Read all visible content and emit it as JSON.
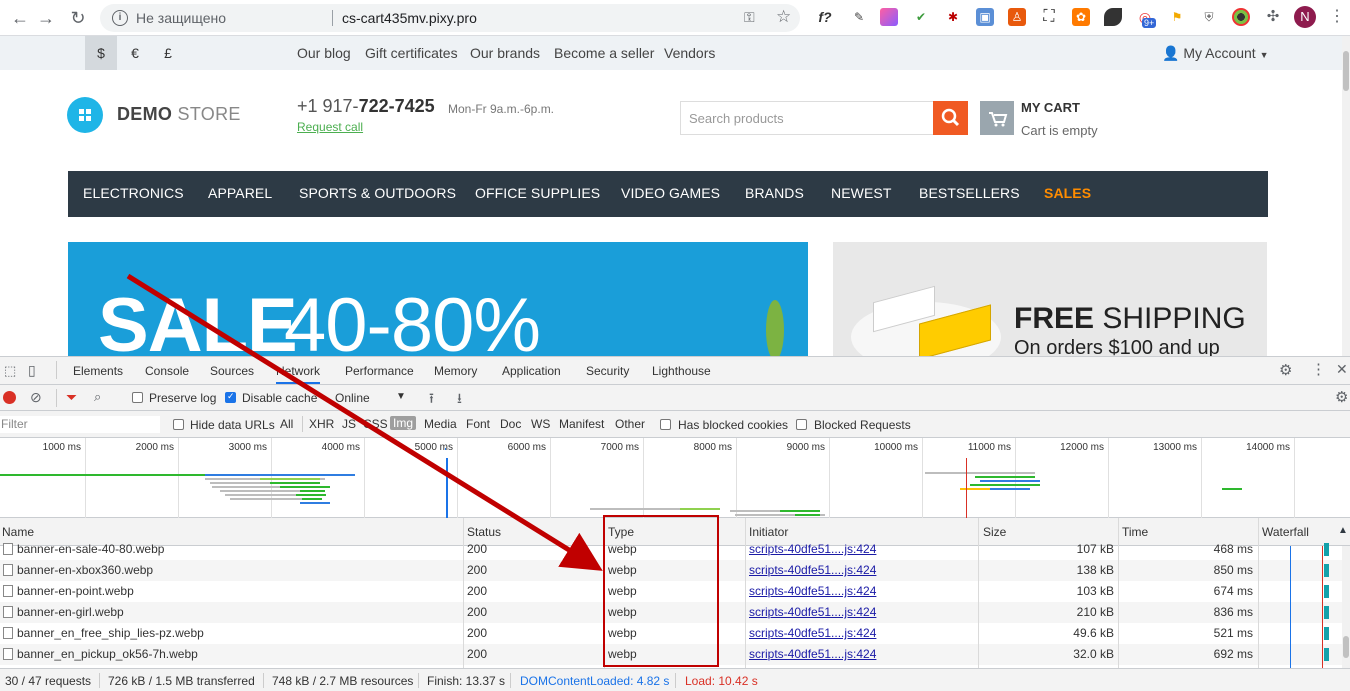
{
  "browser": {
    "security_label": "Не защищено",
    "url": "cs-cart435mv.pixy.pro",
    "avatar_letter": "N",
    "ext_badge": "9+"
  },
  "store": {
    "currencies": [
      "$",
      "€",
      "£"
    ],
    "top_links": [
      "Our blog",
      "Gift certificates",
      "Our brands",
      "Become a seller",
      "Vendors"
    ],
    "my_account": "My Account",
    "logo_bold": "DEMO",
    "logo_light": "STORE",
    "phone_prefix": "+1 917-",
    "phone_main": "722-7425",
    "hours": "Mon-Fr 9a.m.-6p.m.",
    "request_call": "Request call",
    "search_placeholder": "Search products",
    "cart_title": "MY CART",
    "cart_sub": "Cart is empty",
    "nav": [
      "ELECTRONICS",
      "APPAREL",
      "SPORTS & OUTDOORS",
      "OFFICE SUPPLIES",
      "VIDEO GAMES",
      "BRANDS",
      "NEWEST",
      "BESTSELLERS",
      "SALES"
    ],
    "banner1_bold": "SALE",
    "banner1_light": "40-80%",
    "banner2_line1_bold": "FREE",
    "banner2_line1_rest": "SHIPPING",
    "banner2_line2": "On orders $100 and up"
  },
  "devtools": {
    "tabs": [
      "Elements",
      "Console",
      "Sources",
      "Network",
      "Performance",
      "Memory",
      "Application",
      "Security",
      "Lighthouse"
    ],
    "active_tab": "Network",
    "preserve_log": "Preserve log",
    "disable_cache": "Disable cache",
    "throttle": "Online",
    "filter_placeholder": "Filter",
    "hide_data_urls": "Hide data URLs",
    "type_filters": [
      "All",
      "XHR",
      "JS",
      "CSS",
      "Img",
      "Media",
      "Font",
      "Doc",
      "WS",
      "Manifest",
      "Other"
    ],
    "selected_type": "Img",
    "blocked_cookies": "Has blocked cookies",
    "blocked_requests": "Blocked Requests",
    "timeline_ticks": [
      "1000 ms",
      "2000 ms",
      "3000 ms",
      "4000 ms",
      "5000 ms",
      "6000 ms",
      "7000 ms",
      "8000 ms",
      "9000 ms",
      "10000 ms",
      "11000 ms",
      "12000 ms",
      "13000 ms",
      "14000 ms"
    ],
    "columns": [
      "Name",
      "Status",
      "Type",
      "Initiator",
      "Size",
      "Time",
      "Waterfall"
    ],
    "rows": [
      {
        "name": "banner-en-sale-40-80.webp",
        "status": "200",
        "type": "webp",
        "initiator": "scripts-40dfe51....js:424",
        "size": "107 kB",
        "time": "468 ms"
      },
      {
        "name": "banner-en-xbox360.webp",
        "status": "200",
        "type": "webp",
        "initiator": "scripts-40dfe51....js:424",
        "size": "138 kB",
        "time": "850 ms"
      },
      {
        "name": "banner-en-point.webp",
        "status": "200",
        "type": "webp",
        "initiator": "scripts-40dfe51....js:424",
        "size": "103 kB",
        "time": "674 ms"
      },
      {
        "name": "banner-en-girl.webp",
        "status": "200",
        "type": "webp",
        "initiator": "scripts-40dfe51....js:424",
        "size": "210 kB",
        "time": "836 ms"
      },
      {
        "name": "banner_en_free_ship_lies-pz.webp",
        "status": "200",
        "type": "webp",
        "initiator": "scripts-40dfe51....js:424",
        "size": "49.6 kB",
        "time": "521 ms"
      },
      {
        "name": "banner_en_pickup_ok56-7h.webp",
        "status": "200",
        "type": "webp",
        "initiator": "scripts-40dfe51....js:424",
        "size": "32.0 kB",
        "time": "692 ms"
      }
    ],
    "status": {
      "requests": "30 / 47 requests",
      "transferred": "726 kB / 1.5 MB transferred",
      "resources": "748 kB / 2.7 MB resources",
      "finish": "Finish: 13.37 s",
      "dcl": "DOMContentLoaded: 4.82 s",
      "load": "Load: 10.42 s"
    }
  },
  "colors": {
    "accent_blue": "#1a73e8",
    "annotation_red": "#c00000",
    "dcl_blue": "#1a73e8",
    "load_red": "#d93025",
    "search_orange": "#f05a23"
  }
}
